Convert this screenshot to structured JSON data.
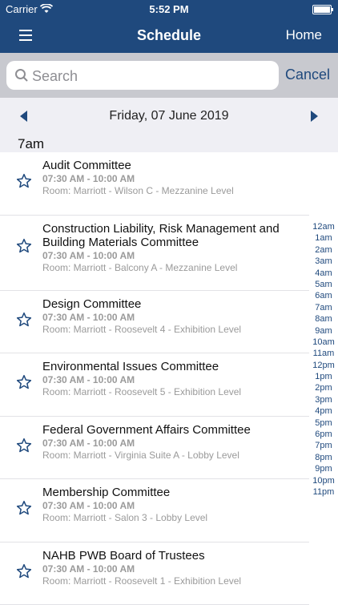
{
  "status": {
    "carrier": "Carrier",
    "time": "5:52 PM"
  },
  "nav": {
    "title": "Schedule",
    "home_label": "Home",
    "menu_icon": "hamburger-menu-icon"
  },
  "search": {
    "placeholder": "Search",
    "cancel_label": "Cancel"
  },
  "date": {
    "label": "Friday, 07 June 2019"
  },
  "hour_header": "7am",
  "events": [
    {
      "name": "Audit Committee",
      "time": "07:30 AM - 10:00 AM",
      "room": "Room: Marriott - Wilson C - Mezzanine Level"
    },
    {
      "name": "Construction Liability, Risk Management and Building Materials Committee",
      "time": "07:30 AM - 10:00 AM",
      "room": "Room: Marriott - Balcony A - Mezzanine Level"
    },
    {
      "name": "Design Committee",
      "time": "07:30 AM - 10:00 AM",
      "room": "Room: Marriott - Roosevelt 4 - Exhibition Level"
    },
    {
      "name": "Environmental Issues Committee",
      "time": "07:30 AM - 10:00 AM",
      "room": "Room: Marriott - Roosevelt 5 - Exhibition Level"
    },
    {
      "name": "Federal Government Affairs Committee",
      "time": "07:30 AM - 10:00 AM",
      "room": "Room: Marriott - Virginia Suite A - Lobby Level"
    },
    {
      "name": "Membership Committee",
      "time": "07:30 AM - 10:00 AM",
      "room": "Room: Marriott - Salon 3 - Lobby Level"
    },
    {
      "name": "NAHB PWB Board of Trustees",
      "time": "07:30 AM - 10:00 AM",
      "room": "Room: Marriott - Roosevelt 1 - Exhibition Level"
    }
  ],
  "hour_index": [
    "12am",
    "1am",
    "2am",
    "3am",
    "4am",
    "5am",
    "6am",
    "7am",
    "8am",
    "9am",
    "10am",
    "11am",
    "12pm",
    "1pm",
    "2pm",
    "3pm",
    "4pm",
    "5pm",
    "6pm",
    "7pm",
    "8pm",
    "9pm",
    "10pm",
    "11pm"
  ],
  "colors": {
    "accent": "#1f497d",
    "nav_bg": "#1f497d"
  }
}
